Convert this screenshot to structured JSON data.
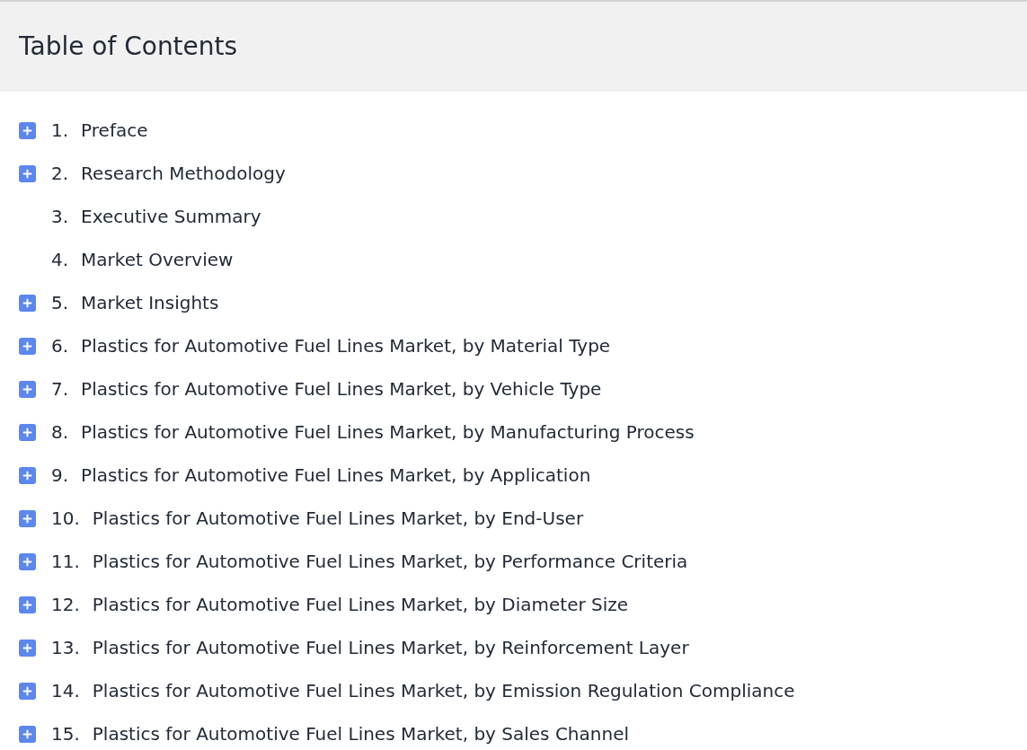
{
  "title": "Table of Contents",
  "items": [
    {
      "number": "1.",
      "label": "Preface",
      "expandable": true
    },
    {
      "number": "2.",
      "label": "Research Methodology",
      "expandable": true
    },
    {
      "number": "3.",
      "label": "Executive Summary",
      "expandable": false
    },
    {
      "number": "4.",
      "label": "Market Overview",
      "expandable": false
    },
    {
      "number": "5.",
      "label": "Market Insights",
      "expandable": true
    },
    {
      "number": "6.",
      "label": "Plastics for Automotive Fuel Lines Market, by Material Type",
      "expandable": true
    },
    {
      "number": "7.",
      "label": "Plastics for Automotive Fuel Lines Market, by Vehicle Type",
      "expandable": true
    },
    {
      "number": "8.",
      "label": "Plastics for Automotive Fuel Lines Market, by Manufacturing Process",
      "expandable": true
    },
    {
      "number": "9.",
      "label": "Plastics for Automotive Fuel Lines Market, by Application",
      "expandable": true
    },
    {
      "number": "10.",
      "label": "Plastics for Automotive Fuel Lines Market, by End-User",
      "expandable": true
    },
    {
      "number": "11.",
      "label": "Plastics for Automotive Fuel Lines Market, by Performance Criteria",
      "expandable": true
    },
    {
      "number": "12.",
      "label": "Plastics for Automotive Fuel Lines Market, by Diameter Size",
      "expandable": true
    },
    {
      "number": "13.",
      "label": "Plastics for Automotive Fuel Lines Market, by Reinforcement Layer",
      "expandable": true
    },
    {
      "number": "14.",
      "label": "Plastics for Automotive Fuel Lines Market, by Emission Regulation Compliance",
      "expandable": true
    },
    {
      "number": "15.",
      "label": "Plastics for Automotive Fuel Lines Market, by Sales Channel",
      "expandable": true
    }
  ]
}
